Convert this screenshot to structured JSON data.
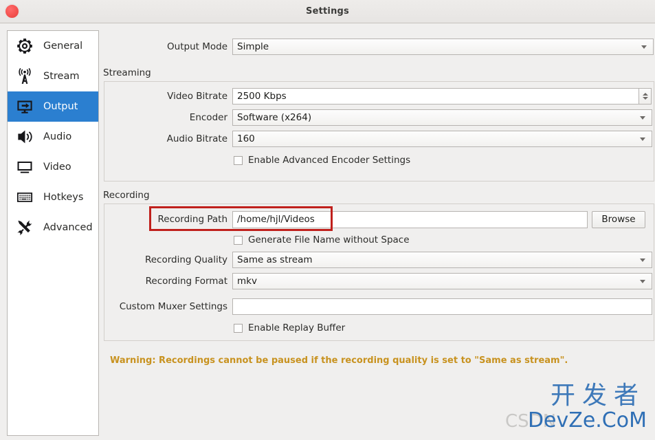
{
  "window": {
    "title": "Settings",
    "close_label": "close"
  },
  "sidebar": {
    "items": [
      {
        "id": "general",
        "label": "General",
        "icon": "gear-icon",
        "selected": false
      },
      {
        "id": "stream",
        "label": "Stream",
        "icon": "antenna-icon",
        "selected": false
      },
      {
        "id": "output",
        "label": "Output",
        "icon": "monitor-arrow-icon",
        "selected": true
      },
      {
        "id": "audio",
        "label": "Audio",
        "icon": "speaker-icon",
        "selected": false
      },
      {
        "id": "video",
        "label": "Video",
        "icon": "monitor-icon",
        "selected": false
      },
      {
        "id": "hotkeys",
        "label": "Hotkeys",
        "icon": "keyboard-icon",
        "selected": false
      },
      {
        "id": "advanced",
        "label": "Advanced",
        "icon": "tools-icon",
        "selected": false
      }
    ]
  },
  "output_mode": {
    "label": "Output Mode",
    "value": "Simple"
  },
  "streaming": {
    "title": "Streaming",
    "video_bitrate": {
      "label": "Video Bitrate",
      "value": "2500 Kbps"
    },
    "encoder": {
      "label": "Encoder",
      "value": "Software (x264)"
    },
    "audio_bitrate": {
      "label": "Audio Bitrate",
      "value": "160"
    },
    "advanced_encoder": {
      "label": "Enable Advanced Encoder Settings",
      "checked": false
    }
  },
  "recording": {
    "title": "Recording",
    "path": {
      "label": "Recording Path",
      "value": "/home/hjl/Videos"
    },
    "browse_label": "Browse",
    "generate_no_space": {
      "label": "Generate File Name without Space",
      "checked": false
    },
    "quality": {
      "label": "Recording Quality",
      "value": "Same as stream"
    },
    "format": {
      "label": "Recording Format",
      "value": "mkv"
    },
    "custom_muxer": {
      "label": "Custom Muxer Settings",
      "value": "",
      "placeholder": ""
    },
    "replay_buffer": {
      "label": "Enable Replay Buffer",
      "checked": false
    }
  },
  "warning": {
    "text": "Warning: Recordings cannot be paused if the recording quality is set to \"Same as stream\"."
  },
  "watermark": {
    "cn": "开发者",
    "en": "DevZe.CoM",
    "ghost": "CSDN"
  },
  "colors": {
    "accent": "#2b7fd0",
    "warning": "#c8921f",
    "annotation": "#c0201c",
    "window_bg": "#f0efee",
    "sidebar_bg": "#ffffff"
  }
}
